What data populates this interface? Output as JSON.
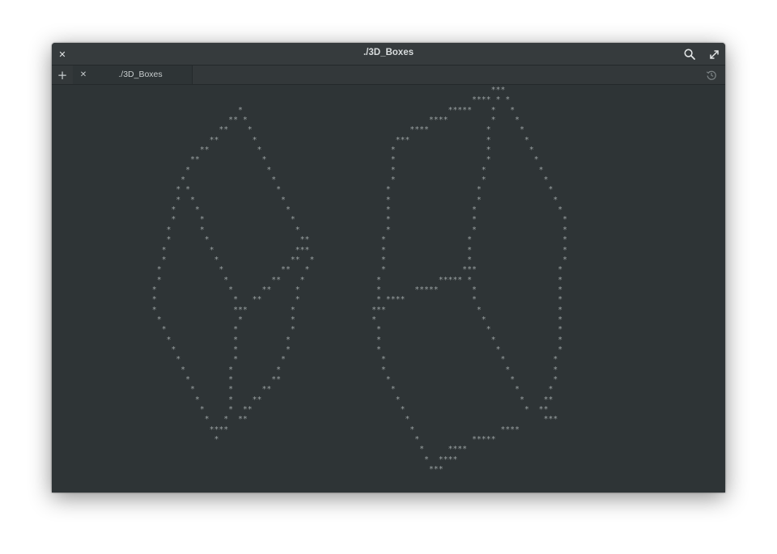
{
  "window": {
    "title": "./3D_Boxes",
    "close_glyph": "✕",
    "icons": {
      "close": "close-icon",
      "search": "search-icon",
      "fullscreen": "fullscreen-icon"
    }
  },
  "tabbar": {
    "new_tab_glyph": "+",
    "tabs": [
      {
        "label": "./3D_Boxes",
        "close_glyph": "✕",
        "active": true
      }
    ],
    "history_icon": "history-icon"
  },
  "terminal": {
    "content": "                                                                         ***\n                                                                     **** * *\n                    *                                           *****    *   *\n                  ** *                                      ****         *    *\n                **    *                                 ****            *      *\n              **       *                             ***                *       *\n            **          *                           *                   *        *\n          **             *                          *                   *         *\n         *                *                         *                  *           *\n        *                  *                        *                  *            *\n       * *                  *                      *                  *              *\n       *  *                  *                     *                  *               *\n      *    *                  *                    *                 *                 *\n      *     *                  *                   *                 *                  *\n     *      *                   *                  *                 *                  *\n     *       *                   **               *                 *                   *\n    *         *                 ***               *                 *                   *\n    *          *               **  *              *                 *                   *\n   *            *            **   *               *                ***                 *\n   *             *         **    *               *            ***** *                  *\n  *               *      **     *                *       *****       *                 *\n  *                *   **       *                * ****              *                 *\n  *                ***         *                ***                   *                *\n   *                *          *                *                      *               *\n    *              *           *                 *                      *              *\n     *             *          *                  *                       *             *\n      *            *          *                  *                        *            *\n       *           *         *                    *                        *          *\n        *         *         *                     *                         *         *\n         *        *        **                      *                         *        *\n          *       *      **                         *                         *      *\n           *      *    **                            *                         *    **\n            *     *  **                               *                         *  **\n             *   *  **                                 *                            ***\n              ****                                      *                  ****\n               *                                         *           *****\n                                                          *     ****\n                                                           *  ****\n                                                            ***"
  }
}
